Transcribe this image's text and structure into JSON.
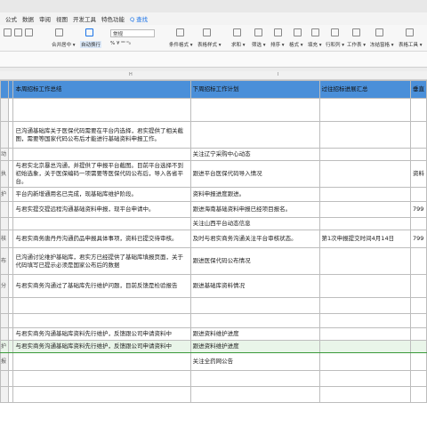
{
  "menu": {
    "items": [
      "公式",
      "数据",
      "审阅",
      "视图",
      "开发工具",
      "特色功能"
    ],
    "search": "Q 查找"
  },
  "ribbon": {
    "merge_center": "合并居中 ▾",
    "wrap_text": "自动换行",
    "number_format": "常规",
    "conditional_format": "条件格式 ▾",
    "table_style": "表格样式 ▾",
    "sum": "求和 ▾",
    "filter": "筛选 ▾",
    "sort": "排序 ▾",
    "format": "格式 ▾",
    "fill": "填充 ▾",
    "row_col": "行和列 ▾",
    "worksheet": "工作表 ▾",
    "freeze": "冻结窗格 ▾",
    "table_tools": "表格工具 ▾"
  },
  "column_headers": {
    "h": "H",
    "i": "I"
  },
  "sheet": {
    "headers": [
      "本周招标工作总结",
      "下周招标工作计划",
      "过往招标进展汇总",
      "垂直"
    ],
    "rows": [
      {
        "no": "",
        "a": "",
        "b": "",
        "c": "",
        "d": "",
        "e": ""
      },
      {
        "no": "",
        "a": "",
        "b": "已沟通基础库关于医保代码需要在平台内选择，君实提供了相关截图，需要等国家代码公布后才能进行基础资料申报工作。",
        "c": "",
        "d": "",
        "e": ""
      },
      {
        "no": "动",
        "a": "",
        "b": "",
        "c": "关注辽宁采购中心动态",
        "d": "",
        "e": ""
      },
      {
        "no": "执",
        "a": "",
        "b": "与君实北京暴总沟通，并提供了申报平台截图。目前平台选择不到初始选象，关于医保编码一项需要等医保代码公布后，导入各省平台。",
        "c": "跟进平台医保代码导入情况",
        "d": "",
        "e": "资料"
      },
      {
        "no": "护",
        "a": "",
        "b": "平台内新增通用名已完成，现基础库维护阶段。",
        "c": "资料申报进度跟进。",
        "d": "",
        "e": ""
      },
      {
        "no": "",
        "a": "",
        "b": "与君实提交提远程沟通基础资料申报，现平台申请中。",
        "c": "跟进海南基础资料申报已经项目报名。",
        "d": "",
        "e": "799"
      },
      {
        "no": "",
        "a": "",
        "b": "",
        "c": "关注山西平台动态信息",
        "d": "",
        "e": ""
      },
      {
        "no": "核",
        "a": "",
        "b": "与君实商务唐丹丹沟通药品申报具体事项，资料已提交待审核。",
        "c": "及时与君实商务沟通关注平台审核状态。",
        "d": "第1次申报提交时间4月14日",
        "e": "799"
      },
      {
        "no": "布",
        "a": "",
        "b": "已沟通讨论维护基础库，君实方已经提供了基础库填报页面，关于代码填写已提示必须是国家公布后的数据",
        "c": "跟进医保代码公布情况",
        "d": "",
        "e": ""
      },
      {
        "no": "分",
        "a": "",
        "b": "与君实商务沟通过了基础库先行维护问题，目前反馈是检验报告",
        "c": "跟进基础库资料情况",
        "d": "",
        "e": ""
      },
      {
        "no": "",
        "a": "",
        "b": "",
        "c": "",
        "d": "",
        "e": ""
      },
      {
        "no": "",
        "a": "",
        "b": "",
        "c": "",
        "d": "",
        "e": ""
      },
      {
        "no": "",
        "a": "",
        "b": "与君实商务沟通基础库资料先行维护，反馈跟公司申请资料中",
        "c": "跟进资料维护进度",
        "d": "",
        "e": ""
      },
      {
        "no": "护",
        "a": "",
        "b": "与君实商务沟通基础库资料先行维护，反馈跟公司申请资料中",
        "c": "跟进资料维护进度",
        "d": "",
        "e": ""
      },
      {
        "no": "报",
        "a": "",
        "b": "",
        "c": "关注全药网公告",
        "d": "",
        "e": ""
      },
      {
        "no": "",
        "a": "",
        "b": "",
        "c": "",
        "d": "",
        "e": ""
      },
      {
        "no": "",
        "a": "",
        "b": "",
        "c": "",
        "d": "",
        "e": ""
      }
    ]
  }
}
